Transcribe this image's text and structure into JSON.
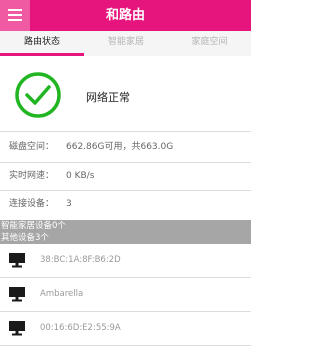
{
  "header": {
    "title": "和路由",
    "menu_icon": "hamburger-menu-icon",
    "color": "#e6157d"
  },
  "tabs": [
    {
      "label": "路由状态",
      "active": true
    },
    {
      "label": "智能家居",
      "active": false
    },
    {
      "label": "家庭空间",
      "active": false
    }
  ],
  "status": {
    "icon": "checkmark-circle-icon",
    "icon_color": "#21b521",
    "text": "网络正常"
  },
  "info": {
    "disk_label": "磁盘空间：",
    "disk_value": "662.86G可用，共663.0G",
    "speed_label": "实时网速：",
    "speed_value": "0 KB/s",
    "devices_label": "连接设备：",
    "devices_value": "3"
  },
  "groups": {
    "smart_home": "智能家居设备0个",
    "other": "其他设备3个"
  },
  "devices": [
    {
      "name": "38:BC:1A:8F:B6:2D",
      "icon": "computer-monitor-icon"
    },
    {
      "name": "Ambarella",
      "icon": "computer-monitor-icon"
    },
    {
      "name": "00:16:6D:E2:55:9A",
      "icon": "computer-monitor-icon"
    }
  ]
}
